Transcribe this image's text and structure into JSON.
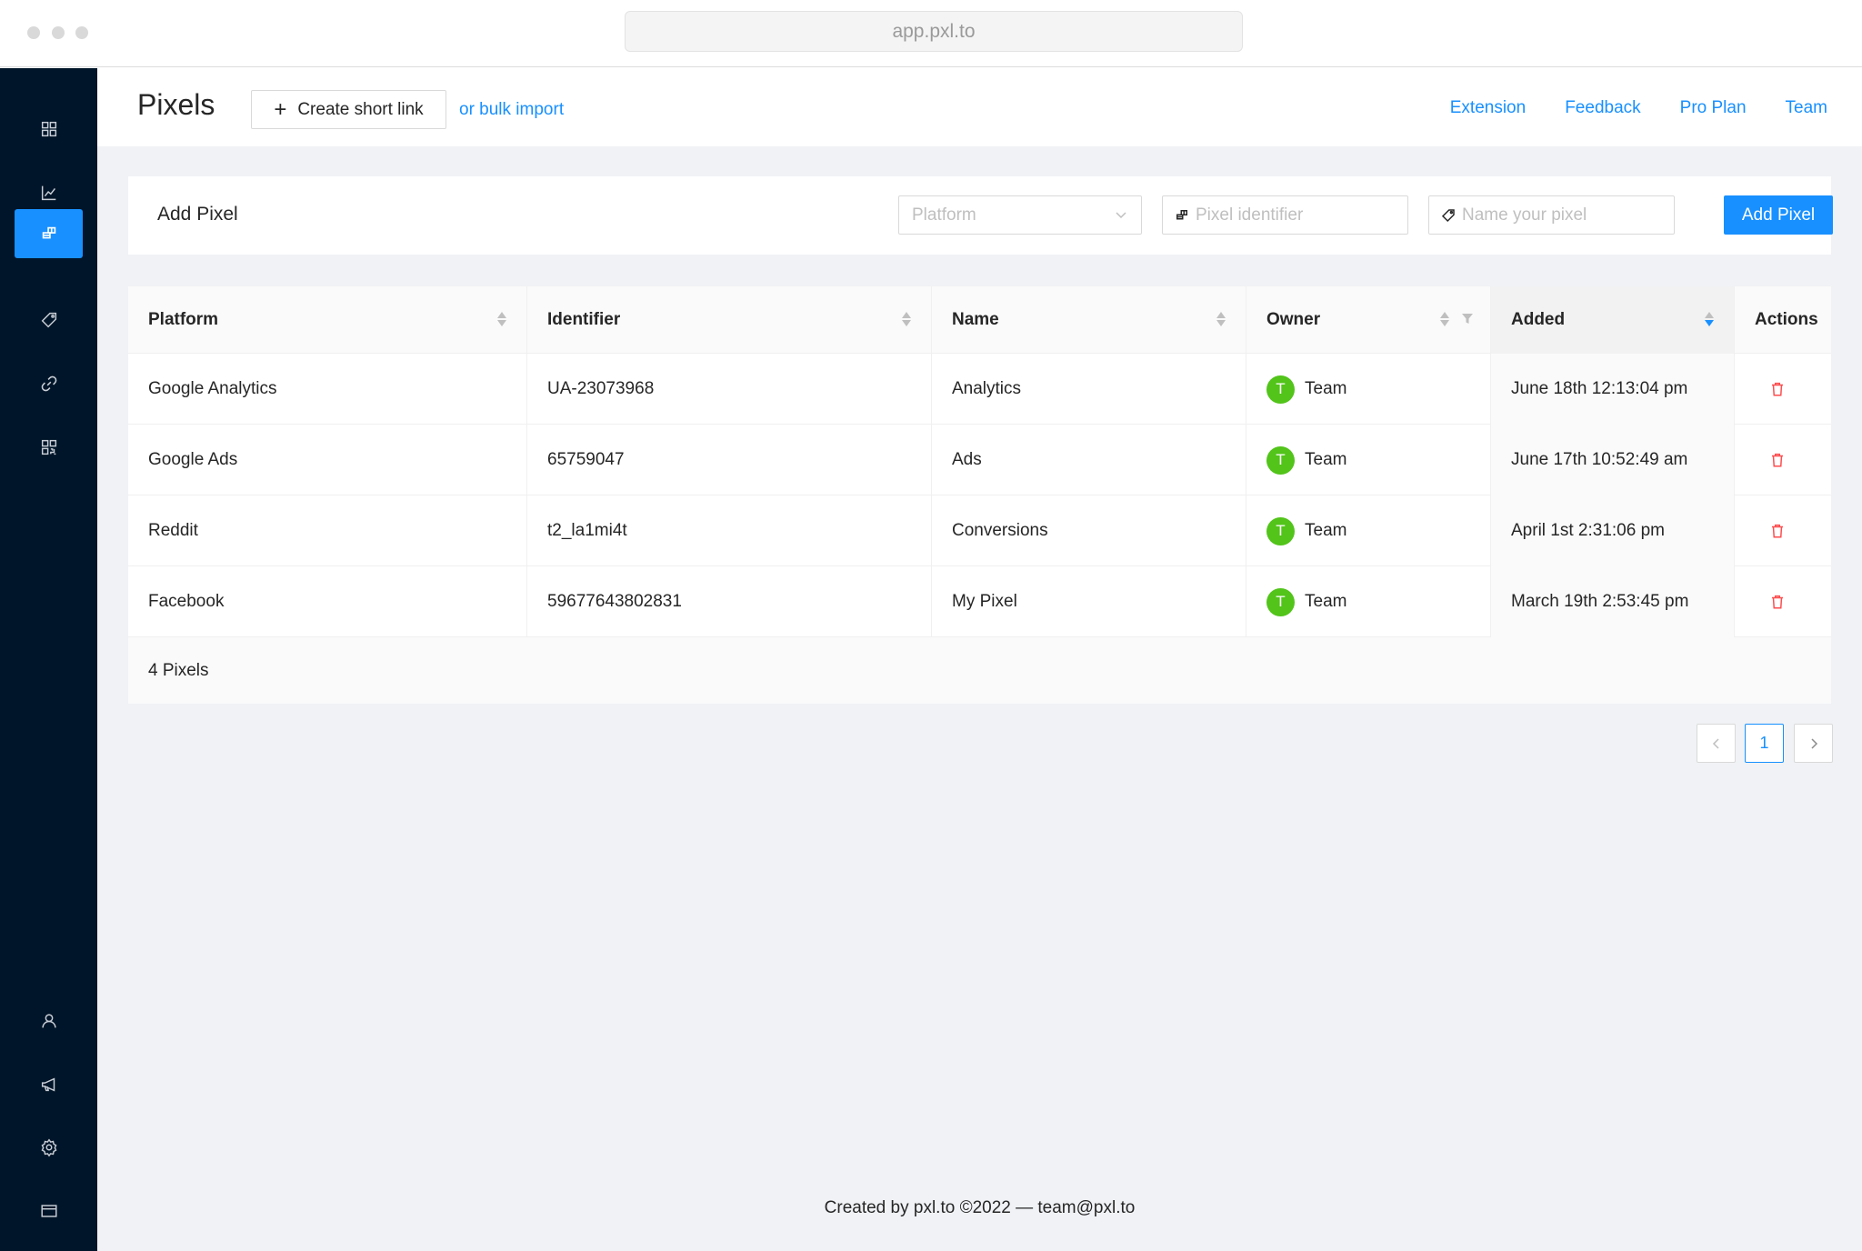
{
  "browser": {
    "url": "app.pxl.to"
  },
  "sidebar": {
    "top_items": [
      {
        "icon": "dashboard-icon"
      },
      {
        "icon": "chart-icon"
      },
      {
        "icon": "pixel-icon",
        "active": true
      },
      {
        "icon": "tag-icon"
      },
      {
        "icon": "link-icon"
      },
      {
        "icon": "qr-code-icon"
      }
    ],
    "bottom_items": [
      {
        "icon": "user-icon"
      },
      {
        "icon": "megaphone-icon"
      },
      {
        "icon": "gear-icon"
      },
      {
        "icon": "credit-card-icon"
      }
    ]
  },
  "header": {
    "title": "Pixels",
    "create_label": "Create short link",
    "bulk_label": "or bulk import",
    "links": [
      "Extension",
      "Feedback",
      "Pro Plan",
      "Team"
    ]
  },
  "add_pixel": {
    "title": "Add Pixel",
    "platform_placeholder": "Platform",
    "identifier_placeholder": "Pixel identifier",
    "name_placeholder": "Name your pixel",
    "button_label": "Add Pixel"
  },
  "table": {
    "columns": [
      "Platform",
      "Identifier",
      "Name",
      "Owner",
      "Added",
      "Actions"
    ],
    "rows": [
      {
        "platform": "Google Analytics",
        "identifier": "UA-23073968",
        "name": "Analytics",
        "owner_initial": "T",
        "owner": "Team",
        "added": "June 18th 12:13:04 pm"
      },
      {
        "platform": "Google Ads",
        "identifier": "65759047",
        "name": "Ads",
        "owner_initial": "T",
        "owner": "Team",
        "added": "June 17th 10:52:49 am"
      },
      {
        "platform": "Reddit",
        "identifier": "t2_la1mi4t",
        "name": "Conversions",
        "owner_initial": "T",
        "owner": "Team",
        "added": "April 1st 2:31:06 pm"
      },
      {
        "platform": "Facebook",
        "identifier": "59677643802831",
        "name": "My Pixel",
        "owner_initial": "T",
        "owner": "Team",
        "added": "March 19th 2:53:45 pm"
      }
    ],
    "footer": "4 Pixels"
  },
  "pagination": {
    "current": "1"
  },
  "footer": {
    "text": "Created by pxl.to ©2022 — team@pxl.to"
  },
  "colors": {
    "primary": "#1890ff",
    "sidebar": "#001529",
    "avatar": "#52c41a",
    "danger": "#ff4d4f",
    "background": "#f0f2f5"
  }
}
